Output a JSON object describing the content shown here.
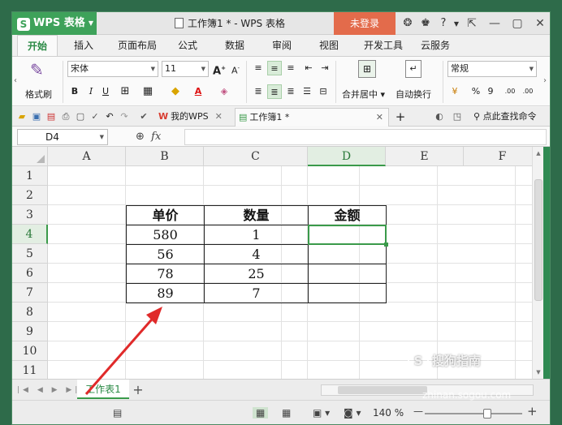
{
  "app": {
    "name": "WPS 表格",
    "doc_title": "工作簿1 * - WPS 表格",
    "login": "未登录"
  },
  "menu": [
    "开始",
    "插入",
    "页面布局",
    "公式",
    "数据",
    "审阅",
    "视图",
    "开发工具",
    "云服务"
  ],
  "ribbon": {
    "format_painter": "格式刷",
    "font_name": "宋体",
    "font_size": "11",
    "merge_center": "合并居中",
    "wrap_text": "自动换行",
    "number_format": "常规",
    "percent": "%",
    "thousands": "9",
    "dec_inc": ".00",
    "dec_dec": ".00"
  },
  "tabs": {
    "my_wps": "我的WPS",
    "workbook": "工作簿1 *",
    "find_command": "点此查找命令"
  },
  "formula": {
    "cell_ref": "D4",
    "fx": "fx"
  },
  "grid": {
    "columns": [
      "A",
      "B",
      "C",
      "D",
      "E",
      "F"
    ],
    "rows": [
      "1",
      "2",
      "3",
      "4",
      "5",
      "6",
      "7",
      "8",
      "9",
      "10",
      "11"
    ],
    "headers": [
      "单价",
      "数量",
      "金额"
    ],
    "data": [
      [
        "580",
        "1",
        ""
      ],
      [
        "56",
        "4",
        ""
      ],
      [
        "78",
        "25",
        ""
      ],
      [
        "89",
        "7",
        ""
      ]
    ]
  },
  "sheet": {
    "tab": "工作表1"
  },
  "status": {
    "zoom": "140 %"
  },
  "watermark": {
    "brand": "搜狗指南",
    "url": "zhinan.sogou.com"
  }
}
